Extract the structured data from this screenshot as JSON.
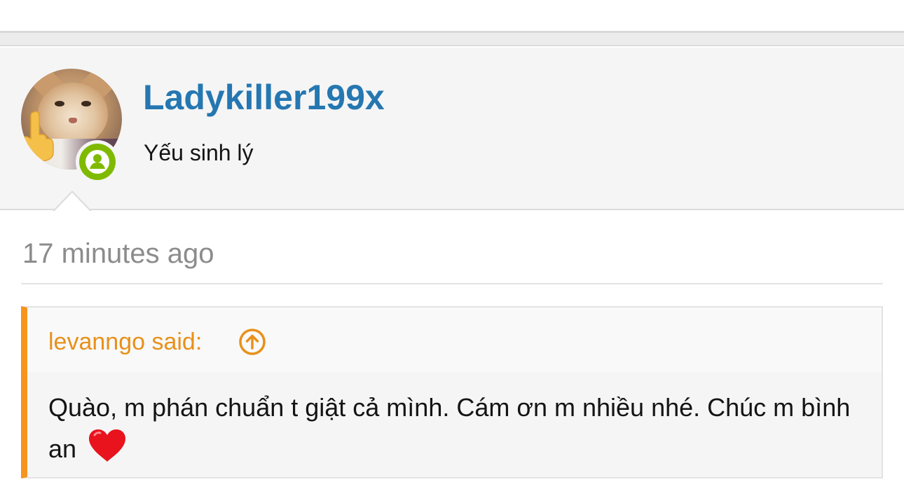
{
  "user": {
    "username": "Ladykiller199x",
    "title": "Yếu sinh lý",
    "status": "online",
    "avatar_icon": "cat-middle-finger-avatar",
    "status_color": "#7fba00",
    "username_color": "#2577b1"
  },
  "post": {
    "timestamp": "17 minutes ago"
  },
  "quote": {
    "author_label": "levanngo said:",
    "jump_icon": "arrow-up-circle-icon",
    "body_text": "Quào, m phán chuẩn t giật cả mình. Cám ơn m nhiều nhé. Chúc m bình an",
    "body_emoji": "heart-icon",
    "accent_color": "#f7941d"
  }
}
